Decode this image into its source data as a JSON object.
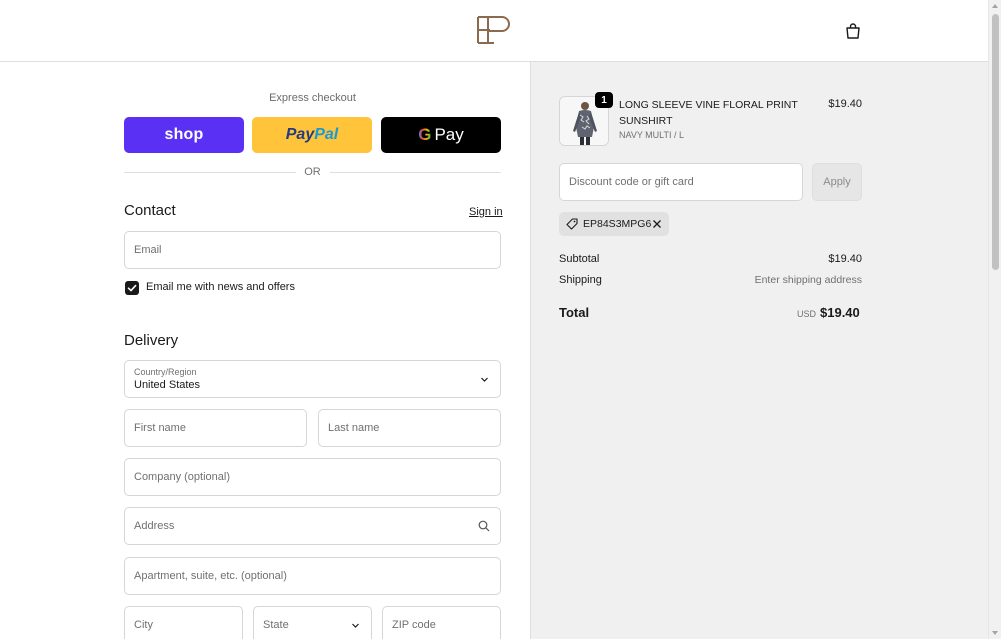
{
  "header": {
    "logo_letters": "EP"
  },
  "express": {
    "label": "Express checkout",
    "shop_label": "shop",
    "paypal_label_1": "Pay",
    "paypal_label_2": "Pal",
    "gpay_g": "G",
    "gpay_label": "Pay",
    "or_label": "OR"
  },
  "contact": {
    "title": "Contact",
    "sign_in": "Sign in",
    "email_placeholder": "Email",
    "newsletter_label": "Email me with news and offers",
    "newsletter_checked": true
  },
  "delivery": {
    "title": "Delivery",
    "country_label": "Country/Region",
    "country_value": "United States",
    "first_name_placeholder": "First name",
    "last_name_placeholder": "Last name",
    "company_placeholder": "Company (optional)",
    "address_placeholder": "Address",
    "apartment_placeholder": "Apartment, suite, etc. (optional)",
    "city_placeholder": "City",
    "state_placeholder": "State",
    "zip_placeholder": "ZIP code"
  },
  "summary": {
    "item": {
      "quantity": "1",
      "name": "LONG SLEEVE VINE FLORAL PRINT SUNSHIRT",
      "variant": "NAVY MULTI / L",
      "price": "$19.40"
    },
    "discount_placeholder": "Discount code or gift card",
    "apply_label": "Apply",
    "applied_code": "EP84S3MPG6",
    "subtotal_label": "Subtotal",
    "subtotal_value": "$19.40",
    "shipping_label": "Shipping",
    "shipping_value": "Enter shipping address",
    "total_label": "Total",
    "total_currency": "USD",
    "total_value": "$19.40"
  },
  "colors": {
    "shop_pay": "#5a31f4",
    "paypal": "#ffc439",
    "gpay": "#000000",
    "summary_bg": "#f0f0f0",
    "logo": "#8b6a4e"
  }
}
